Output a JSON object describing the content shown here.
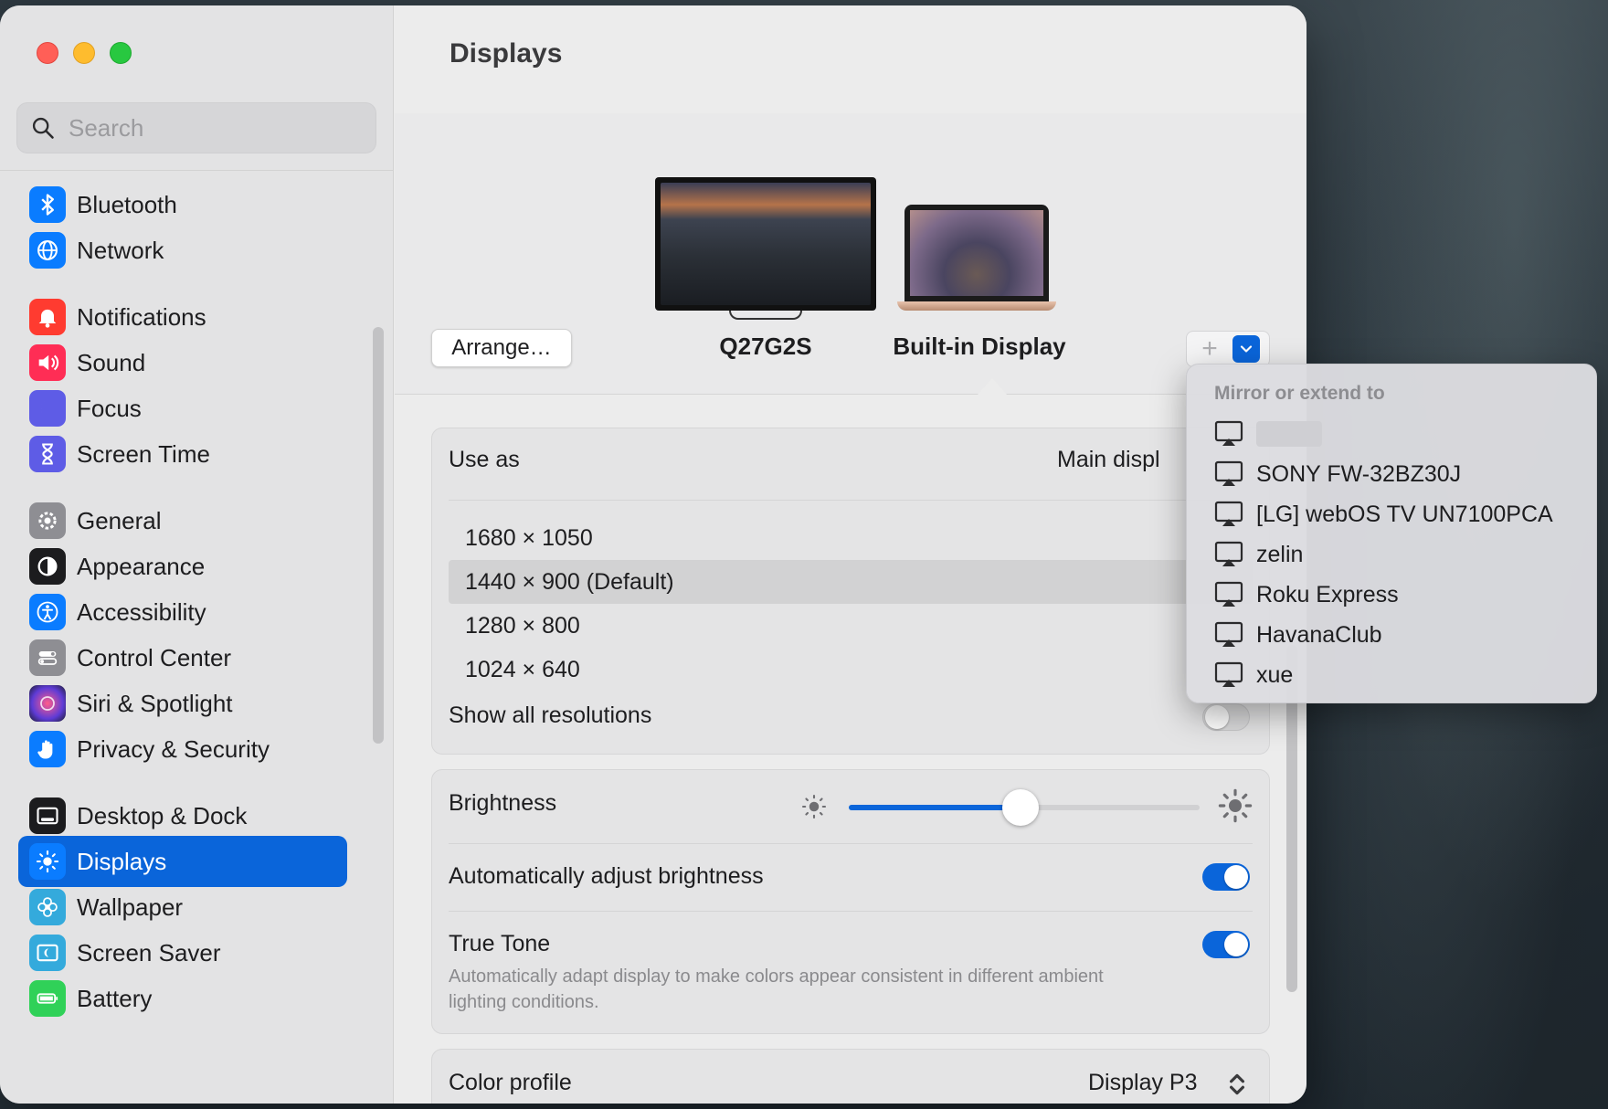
{
  "window": {
    "title": "Displays"
  },
  "search": {
    "placeholder": "Search"
  },
  "sidebar": {
    "items": [
      {
        "label": "Bluetooth",
        "icon": "bluetooth-icon",
        "color": "#0a7cff"
      },
      {
        "label": "Network",
        "icon": "globe-icon",
        "color": "#0a7cff"
      },
      {
        "label": "Notifications",
        "icon": "bell-icon",
        "color": "#ff3b30"
      },
      {
        "label": "Sound",
        "icon": "speaker-icon",
        "color": "#ff2d55"
      },
      {
        "label": "Focus",
        "icon": "moon-icon",
        "color": "#5e5ce6"
      },
      {
        "label": "Screen Time",
        "icon": "hourglass-icon",
        "color": "#5e5ce6"
      },
      {
        "label": "General",
        "icon": "gear-icon",
        "color": "#8e8e93"
      },
      {
        "label": "Appearance",
        "icon": "appearance-icon",
        "color": "#1c1c1e"
      },
      {
        "label": "Accessibility",
        "icon": "accessibility-icon",
        "color": "#0a7cff"
      },
      {
        "label": "Control Center",
        "icon": "switches-icon",
        "color": "#8e8e93"
      },
      {
        "label": "Siri & Spotlight",
        "icon": "siri-icon",
        "color": "#3a2a6e"
      },
      {
        "label": "Privacy & Security",
        "icon": "hand-icon",
        "color": "#0a7cff"
      },
      {
        "label": "Desktop & Dock",
        "icon": "dock-icon",
        "color": "#1c1c1e"
      },
      {
        "label": "Displays",
        "icon": "sun-icon",
        "color": "#0a7cff"
      },
      {
        "label": "Wallpaper",
        "icon": "flower-icon",
        "color": "#34aadc"
      },
      {
        "label": "Screen Saver",
        "icon": "screensaver-icon",
        "color": "#34aadc"
      },
      {
        "label": "Battery",
        "icon": "battery-icon",
        "color": "#30d158"
      }
    ]
  },
  "displays": {
    "external_name": "Q27G2S",
    "builtin_name": "Built-in Display",
    "arrange_label": "Arrange…",
    "add_label": "+"
  },
  "settings": {
    "use_as_label": "Use as",
    "use_as_value": "Main displ",
    "resolutions": [
      "1680 × 1050",
      "1440 × 900 (Default)",
      "1280 × 800",
      "1024 × 640"
    ],
    "selected_resolution": "1440 × 900 (Default)",
    "show_all_label": "Show all resolutions",
    "show_all_on": false,
    "brightness_label": "Brightness",
    "brightness_level": 0.49,
    "auto_brightness_label": "Automatically adjust brightness",
    "auto_brightness_on": true,
    "true_tone_label": "True Tone",
    "true_tone_desc": "Automatically adapt display to make colors appear consistent in different ambient lighting conditions.",
    "true_tone_on": true,
    "color_profile_label": "Color profile",
    "color_profile_value": "Display P3"
  },
  "popup": {
    "header": "Mirror or extend to",
    "items": [
      "",
      "SONY FW-32BZ30J",
      "[LG] webOS TV UN7100PCA",
      "zelin",
      "Roku Express",
      "HavanaClub",
      "xue"
    ]
  },
  "colors": {
    "accent": "#0a65da"
  }
}
